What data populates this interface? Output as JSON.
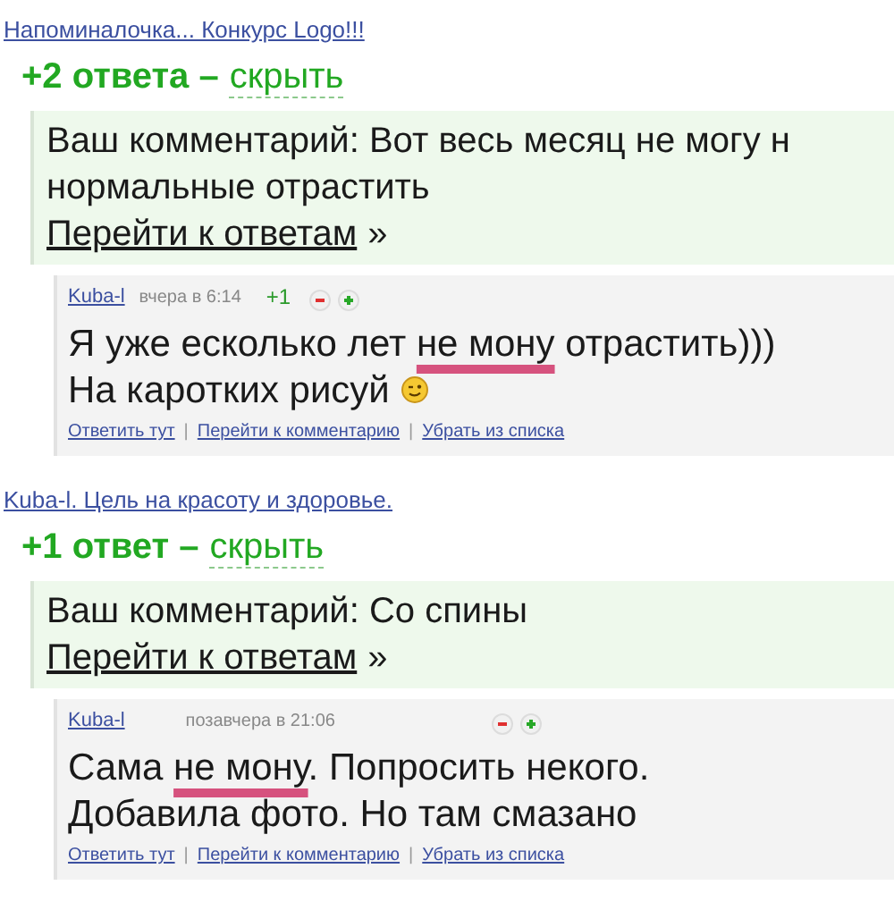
{
  "threads": [
    {
      "title": "Напоминалочка... Конкурс Logo!!!",
      "count": "+2 ответа –",
      "toggle": "скрыть",
      "my_comment": {
        "label": "Ваш комментарий:",
        "text": "Вот весь месяц не могу н",
        "text2": "нормальные отрастить",
        "link": "Перейти к ответам",
        "arrow": "»"
      },
      "reply": {
        "author": "Kuba-l",
        "time": "вчера в 6:14",
        "score": "+1",
        "lines": [
          [
            {
              "kind": "text",
              "text": "Я уже есколько лет "
            },
            {
              "kind": "text",
              "text": "не мону",
              "marked": true
            },
            {
              "kind": "text",
              "text": " отрастить)))"
            }
          ],
          [
            {
              "kind": "text",
              "text": "На каротких рисуй "
            },
            {
              "kind": "emoticon"
            }
          ]
        ],
        "actions": [
          "Ответить тут",
          "Перейти к комментарию",
          "Убрать из списка"
        ],
        "separators": [
          "|",
          "|"
        ]
      }
    },
    {
      "title": "Kuba-l. Цель на красоту и здоровье.",
      "count": "+1 ответ –",
      "toggle": "скрыть",
      "my_comment": {
        "label": "Ваш комментарий:",
        "text": "Со спины",
        "link": "Перейти к ответам",
        "arrow": "»"
      },
      "reply": {
        "author": "Kuba-l",
        "time": "позавчера в 21:06",
        "lines": [
          [
            {
              "kind": "text",
              "text": "Сама "
            },
            {
              "kind": "text",
              "text": "не мону",
              "marked": true
            },
            {
              "kind": "text",
              "text": ". Попросить некого."
            }
          ],
          [
            {
              "kind": "text",
              "text": "Добавила фото. Но там смазано"
            }
          ]
        ],
        "actions": [
          "Ответить тут",
          "Перейти к комментарию",
          "Убрать из списка"
        ],
        "separators": [
          "|",
          "|"
        ]
      }
    }
  ]
}
